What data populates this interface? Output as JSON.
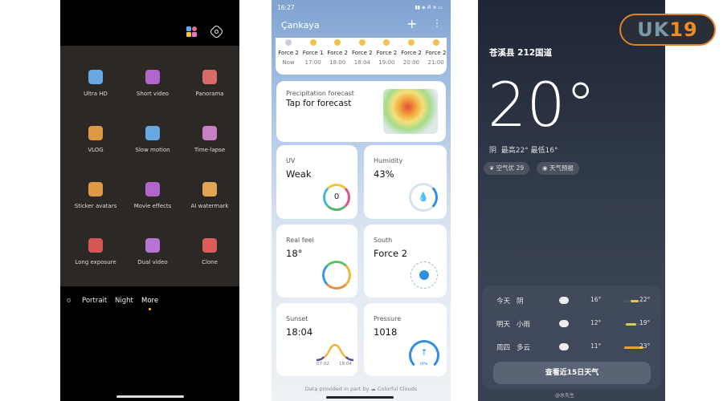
{
  "camera": {
    "modes": [
      {
        "label": "Ultra HD",
        "icon": "ultra-hd-icon",
        "color": "#6fb6f5"
      },
      {
        "label": "Short video",
        "icon": "short-video-icon",
        "color": "#c06be0"
      },
      {
        "label": "Panorama",
        "icon": "panorama-icon",
        "color": "#e9736e"
      },
      {
        "label": "VLOG",
        "icon": "vlog-icon",
        "color": "#f0a54a"
      },
      {
        "label": "Slow motion",
        "icon": "slow-motion-icon",
        "color": "#6fb6f5"
      },
      {
        "label": "Time-lapse",
        "icon": "time-lapse-icon",
        "color": "#d88ad8"
      },
      {
        "label": "Sticker avatars",
        "icon": "sticker-avatars-icon",
        "color": "#f3a64d"
      },
      {
        "label": "Movie effects",
        "icon": "movie-effects-icon",
        "color": "#c06be0"
      },
      {
        "label": "AI watermark",
        "icon": "ai-watermark-icon",
        "color": "#f5b25a"
      },
      {
        "label": "Long exposure",
        "icon": "long-exposure-icon",
        "color": "#e85b5b"
      },
      {
        "label": "Dual video",
        "icon": "dual-video-icon",
        "color": "#c77ce8"
      },
      {
        "label": "Clone",
        "icon": "clone-icon",
        "color": "#ef6262"
      }
    ],
    "tabs": [
      "o",
      "Portrait",
      "Night",
      "More"
    ],
    "active_tab": "More"
  },
  "weather1": {
    "time": "16:27",
    "city": "Çankaya",
    "hourly": [
      {
        "force": "Force 2",
        "time": "Now"
      },
      {
        "force": "Force 1",
        "time": "17:00"
      },
      {
        "force": "Force 2",
        "time": "18:00"
      },
      {
        "force": "Force 2",
        "time": "18:04"
      },
      {
        "force": "Force 2",
        "time": "19:00"
      },
      {
        "force": "Force 2",
        "time": "20:00"
      },
      {
        "force": "Force 2",
        "time": "21:00"
      }
    ],
    "precip": {
      "label": "Precipitation forecast",
      "value": "Tap for forecast"
    },
    "uv": {
      "label": "UV",
      "value": "Weak",
      "index": "0"
    },
    "humidity": {
      "label": "Humidity",
      "value": "43%"
    },
    "realfeel": {
      "label": "Real feel",
      "value": "18°"
    },
    "wind": {
      "label": "South",
      "value": "Force 2"
    },
    "sunset": {
      "label": "Sunset",
      "value": "18:04",
      "rise": "07:02",
      "set": "18:04"
    },
    "pressure": {
      "label": "Pressure",
      "value": "1018",
      "unit": "hPa"
    },
    "footer": "Data provided in part by",
    "provider": "Colorful Clouds"
  },
  "weather2": {
    "location": "苍溪县 212国道",
    "temp": "20°",
    "summary": "阴  最高22° 最低16°",
    "aqi": "空气优 29",
    "forecast_chip": "天气预报",
    "days": [
      {
        "day": "今天",
        "cond": "阴",
        "low": "16°",
        "high": "22°",
        "icon": "cloudy-icon"
      },
      {
        "day": "明天",
        "cond": "小雨",
        "low": "12°",
        "high": "19°",
        "icon": "rain-icon"
      },
      {
        "day": "周四",
        "cond": "多云",
        "low": "11°",
        "high": "23°",
        "icon": "partly-cloudy-icon"
      }
    ],
    "button": "查看近15日天气",
    "watermark": "@水先生",
    "logo": "UK19"
  }
}
